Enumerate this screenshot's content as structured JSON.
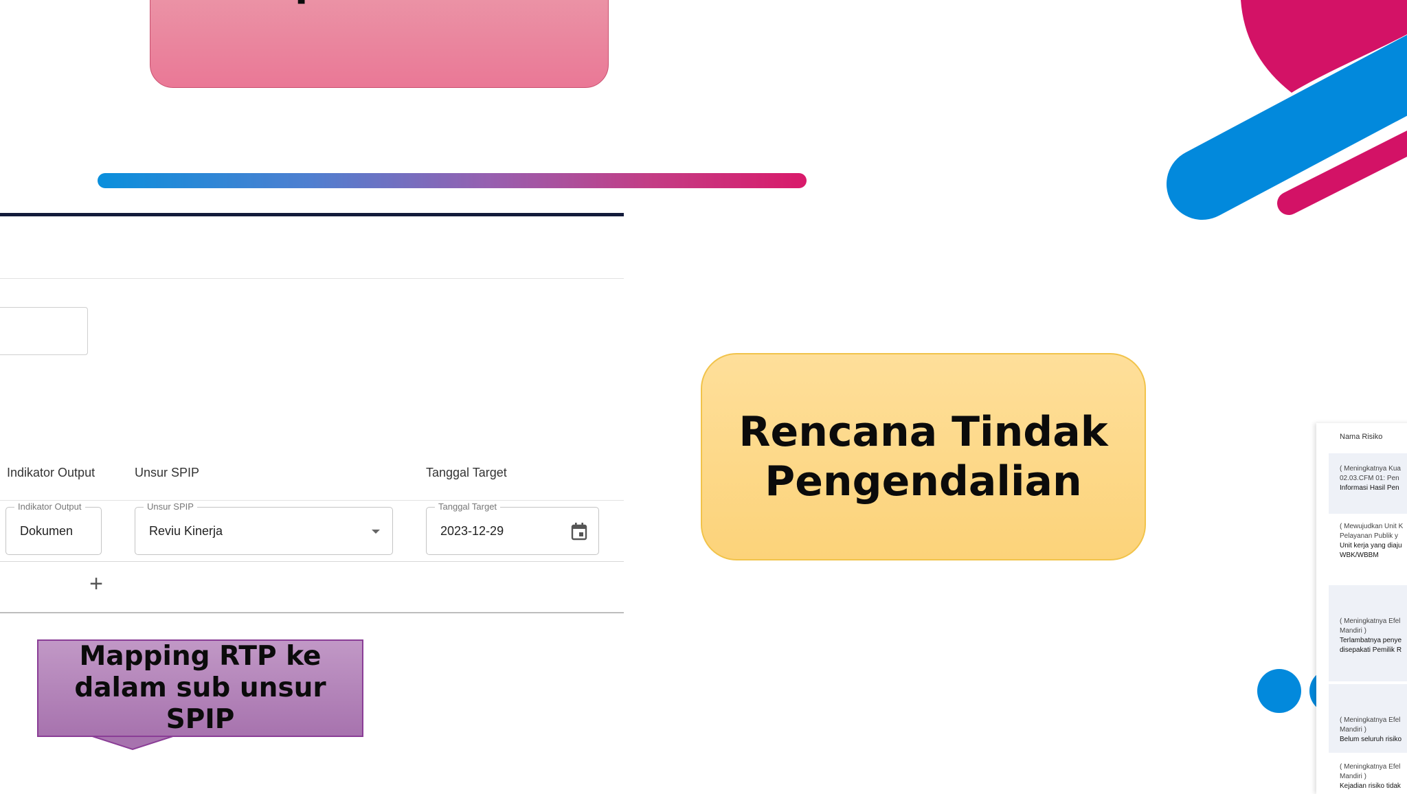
{
  "slide": {
    "title_top": "Respons Risiko",
    "title_main": "Rencana Tindak Pengendalian",
    "callout": "Mapping RTP ke dalam sub unsur SPIP"
  },
  "form": {
    "columns": [
      "Indikator Output",
      "Unsur SPIP",
      "Tanggal Target"
    ],
    "fields": {
      "indikator_output": {
        "label": "Indikator Output",
        "value": "Dokumen"
      },
      "unsur_spip": {
        "label": "Unsur SPIP",
        "value": "Reviu Kinerja"
      },
      "tanggal_target": {
        "label": "Tanggal Target",
        "value": "2023-12-29"
      }
    },
    "add_row_icon": "plus-icon"
  },
  "risk_table": {
    "header": "Nama Risiko",
    "rows": [
      {
        "lines": [
          "( Meningkatnya Kua",
          "02.03.CFM 01: Pen"
        ],
        "strong": "Informasi Hasil Pen"
      },
      {
        "lines": [
          "( Mewujudkan Unit K",
          "Pelayanan Publik y"
        ],
        "strong": "Unit kerja yang diaju",
        "strong2": "WBK/WBBM"
      },
      {
        "lines": [
          "( Meningkatnya Efel",
          "Mandiri )"
        ],
        "strong": "Terlambatnya penye",
        "strong2": "disepakati Pemilik R"
      },
      {
        "lines": [
          "( Meningkatnya Efel",
          "Mandiri )"
        ],
        "strong": "Belum seluruh risiko"
      },
      {
        "lines": [
          "( Meningkatnya Efel",
          "Mandiri )"
        ],
        "strong": "Kejadian risiko tidak"
      }
    ]
  },
  "colors": {
    "pink_box": "#ea7896",
    "orange_box": "#fcd37a",
    "purple_callout": "#a773ae",
    "brand_blue": "#0289dc",
    "brand_magenta": "#d31266"
  }
}
